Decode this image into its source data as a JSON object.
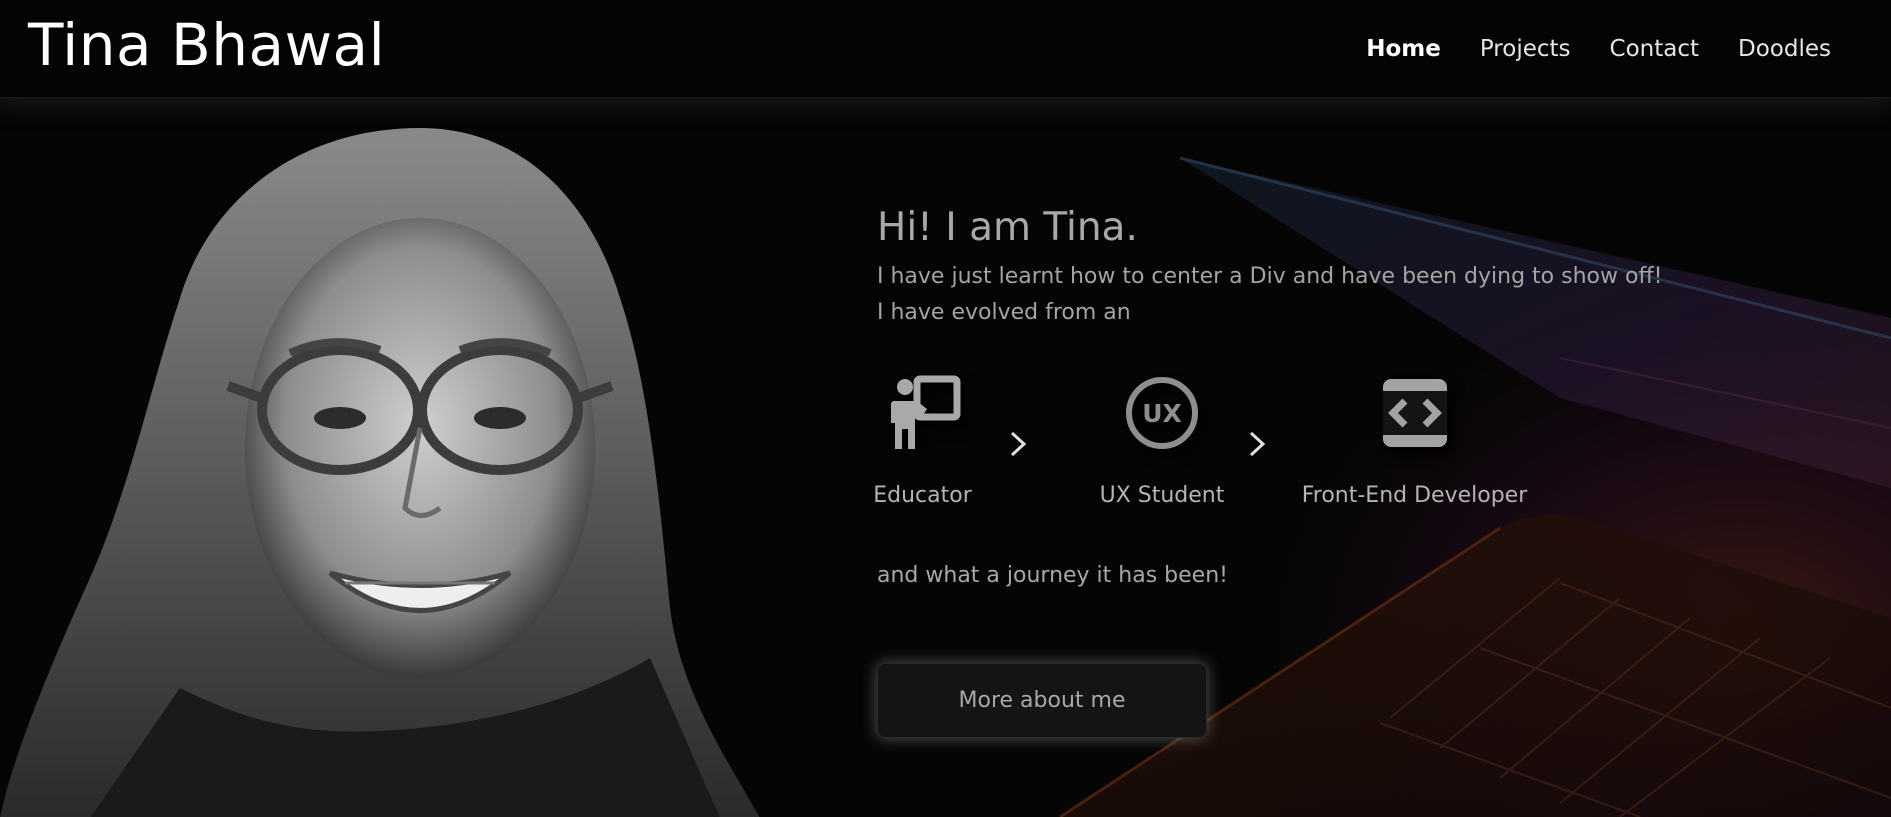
{
  "header": {
    "brand": "Tina Bhawal",
    "nav": [
      "Home",
      "Projects",
      "Contact",
      "Doodles"
    ],
    "active_nav": "Home"
  },
  "hero": {
    "title": "Hi! I am Tina.",
    "line1": "I have just learnt how to center a Div and have been dying to show off!",
    "line2": "I have evolved from an",
    "steps": [
      {
        "label": "Educator",
        "icon": "teacher-board-icon"
      },
      {
        "label": "UX Student",
        "icon": "ux-badge-icon"
      },
      {
        "label": "Front-End Developer",
        "icon": "code-window-icon"
      }
    ],
    "outro": "and what a journey it has been!",
    "cta_label": "More about me"
  },
  "colors": {
    "background": "#050505",
    "accent_text": "#a8a8a8",
    "laptop_glow": "#b0501e"
  }
}
